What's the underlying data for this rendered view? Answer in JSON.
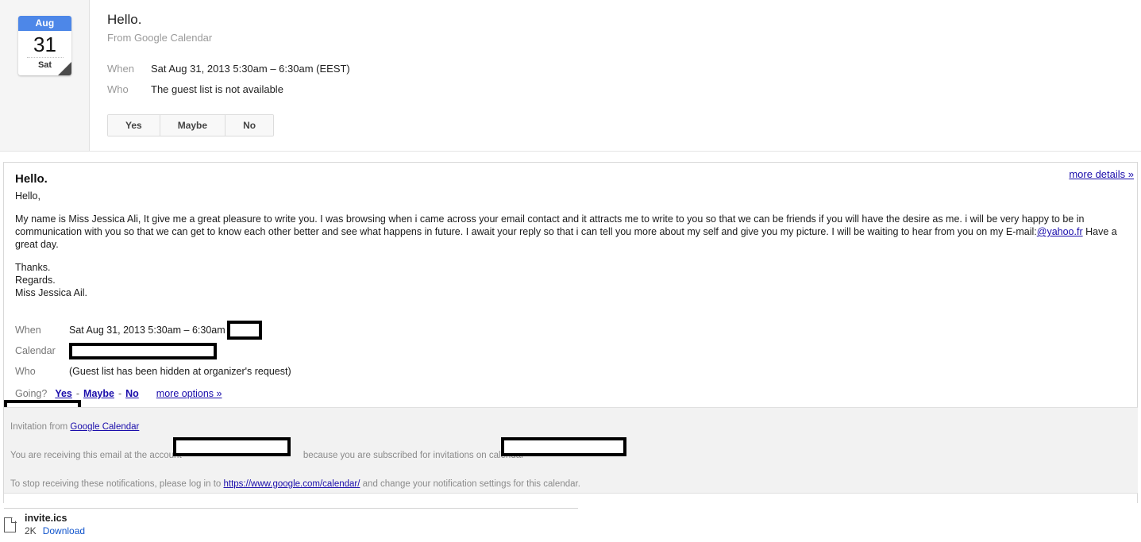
{
  "invitation_card": {
    "date_chip": {
      "month": "Aug",
      "day": "31",
      "weekday": "Sat"
    },
    "title": "Hello.",
    "from": "From Google Calendar",
    "fields": [
      {
        "label": "When",
        "value": "Sat Aug 31, 2013 5:30am – 6:30am (EEST)"
      },
      {
        "label": "Who",
        "value": "The guest list is not available"
      }
    ],
    "rsvp": {
      "yes": "Yes",
      "maybe": "Maybe",
      "no": "No"
    }
  },
  "message": {
    "more_details": "more details »",
    "heading": "Hello.",
    "greeting": "Hello,",
    "paragraph_part1": "My name is Miss Jessica Ali, It give me a great pleasure to write you. I was browsing when i came across your email contact and it attracts me to write to you so that we can be friends if you will have the desire as me. i will be very happy to be in communication with you so that we can get to know each other better and see what happens in future. I await your reply so that i can tell you more about my self and give you my picture. I will be waiting to hear from you on my E-mail:",
    "email_domain": "@yahoo.fr",
    "paragraph_part2": " Have a great day.",
    "signoff_1": "Thanks.",
    "signoff_2": "Regards.",
    "signoff_3": "Miss Jessica Ail."
  },
  "event_details": {
    "when_label": "When",
    "when_value": "Sat Aug 31, 2013 5:30am – 6:30am",
    "calendar_label": "Calendar",
    "who_label": "Who",
    "who_value": "(Guest list has been hidden at organizer's request)",
    "going_label": "Going?",
    "going_yes": "Yes",
    "going_maybe": "Maybe",
    "going_no": "No",
    "going_sep": "-",
    "more_options": "more options »"
  },
  "footer": {
    "invitation_from_prefix": "Invitation from ",
    "google_calendar_link": "Google Calendar",
    "account_prefix": "You are receiving this email at the account",
    "account_suffix": "because you are subscribed for invitations on calendar",
    "stop_prefix": "To stop receiving these notifications, please log in to ",
    "calendar_url": "https://www.google.com/calendar/",
    "stop_suffix": " and change your notification settings for this calendar."
  },
  "attachment": {
    "name": "invite.ics",
    "size": "2K",
    "download": "Download"
  },
  "colors": {
    "calendar_chip_header": "#4d87e8",
    "link": "#1a0dab",
    "download_link": "#1155cc",
    "label_gray": "#999999",
    "footer_bg": "#f2f2f2",
    "panel_bg": "#f5f5f5",
    "redaction": "#000000"
  }
}
